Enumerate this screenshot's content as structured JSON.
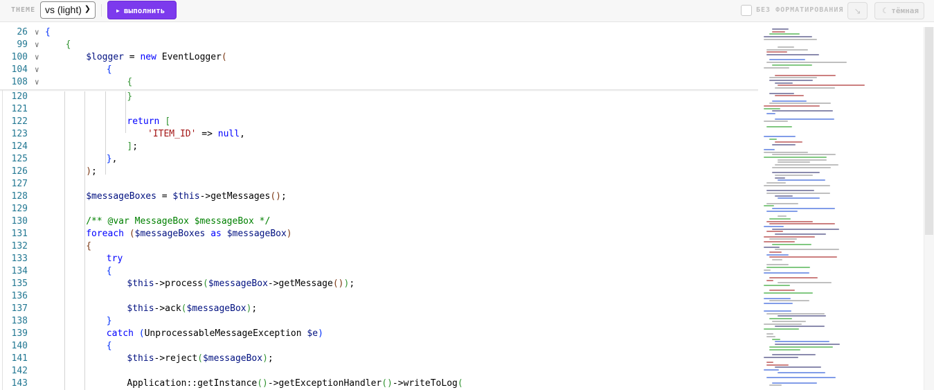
{
  "toolbar": {
    "theme_label": "THEME",
    "theme_value": "vs (light)",
    "run_label": "выполнить",
    "no_format_label": "БЕЗ ФОРМАТИРОВАНИЯ",
    "dark_label": "тёмная"
  },
  "colors": {
    "accent": "#7c3aed",
    "line_number": "#237893",
    "keyword": "#0000ff",
    "variable": "#001080",
    "string": "#a31515",
    "comment": "#008000"
  },
  "sticky_lines": [
    {
      "number": "26",
      "indent": 0,
      "tokens": [
        [
          "b1",
          "{"
        ]
      ]
    },
    {
      "number": "99",
      "indent": 1,
      "tokens": [
        [
          "b2",
          "{"
        ]
      ]
    },
    {
      "number": "100",
      "indent": 2,
      "tokens": [
        [
          "var",
          "$logger"
        ],
        [
          "",
          " = "
        ],
        [
          "kw",
          "new"
        ],
        [
          "",
          " EventLogger"
        ],
        [
          "b3",
          "("
        ]
      ]
    },
    {
      "number": "104",
      "indent": 3,
      "tokens": [
        [
          "b1",
          "{"
        ]
      ]
    },
    {
      "number": "108",
      "indent": 4,
      "tokens": [
        [
          "b2",
          "{"
        ]
      ]
    }
  ],
  "lines": [
    {
      "number": "120",
      "indent": 4,
      "tokens": [
        [
          "b2",
          "}"
        ]
      ]
    },
    {
      "number": "121",
      "indent": 0,
      "tokens": []
    },
    {
      "number": "122",
      "indent": 4,
      "tokens": [
        [
          "kw",
          "return"
        ],
        [
          "",
          " "
        ],
        [
          "b2",
          "["
        ]
      ]
    },
    {
      "number": "123",
      "indent": 5,
      "tokens": [
        [
          "str",
          "'ITEM_ID'"
        ],
        [
          "",
          " => "
        ],
        [
          "kw",
          "null"
        ],
        [
          "",
          ","
        ]
      ]
    },
    {
      "number": "124",
      "indent": 4,
      "tokens": [
        [
          "b2",
          "]"
        ],
        [
          "",
          ";"
        ]
      ]
    },
    {
      "number": "125",
      "indent": 3,
      "tokens": [
        [
          "b1",
          "}"
        ],
        [
          "",
          ","
        ]
      ]
    },
    {
      "number": "126",
      "indent": 2,
      "tokens": [
        [
          "b3",
          ")"
        ],
        [
          "",
          ";"
        ]
      ]
    },
    {
      "number": "127",
      "indent": 0,
      "tokens": []
    },
    {
      "number": "128",
      "indent": 2,
      "tokens": [
        [
          "var",
          "$messageBoxes"
        ],
        [
          "",
          " = "
        ],
        [
          "var",
          "$this"
        ],
        [
          "",
          "->getMessages"
        ],
        [
          "b3",
          "()"
        ],
        [
          "",
          ";"
        ]
      ]
    },
    {
      "number": "129",
      "indent": 0,
      "tokens": []
    },
    {
      "number": "130",
      "indent": 2,
      "tokens": [
        [
          "cmt",
          "/** @var MessageBox $messageBox */"
        ]
      ]
    },
    {
      "number": "131",
      "indent": 2,
      "tokens": [
        [
          "kw",
          "foreach"
        ],
        [
          "",
          " "
        ],
        [
          "b3",
          "("
        ],
        [
          "var",
          "$messageBoxes"
        ],
        [
          "",
          " "
        ],
        [
          "kw",
          "as"
        ],
        [
          "",
          " "
        ],
        [
          "var",
          "$messageBox"
        ],
        [
          "b3",
          ")"
        ]
      ]
    },
    {
      "number": "132",
      "indent": 2,
      "tokens": [
        [
          "b3",
          "{"
        ]
      ]
    },
    {
      "number": "133",
      "indent": 3,
      "tokens": [
        [
          "kw",
          "try"
        ]
      ]
    },
    {
      "number": "134",
      "indent": 3,
      "tokens": [
        [
          "b1",
          "{"
        ]
      ]
    },
    {
      "number": "135",
      "indent": 4,
      "tokens": [
        [
          "var",
          "$this"
        ],
        [
          "",
          "->process"
        ],
        [
          "b2",
          "("
        ],
        [
          "var",
          "$messageBox"
        ],
        [
          "",
          "->getMessage"
        ],
        [
          "b3",
          "()"
        ],
        [
          "b2",
          ")"
        ],
        [
          "",
          ";"
        ]
      ]
    },
    {
      "number": "136",
      "indent": 0,
      "tokens": []
    },
    {
      "number": "137",
      "indent": 4,
      "tokens": [
        [
          "var",
          "$this"
        ],
        [
          "",
          "->ack"
        ],
        [
          "b2",
          "("
        ],
        [
          "var",
          "$messageBox"
        ],
        [
          "b2",
          ")"
        ],
        [
          "",
          ";"
        ]
      ]
    },
    {
      "number": "138",
      "indent": 3,
      "tokens": [
        [
          "b1",
          "}"
        ]
      ]
    },
    {
      "number": "139",
      "indent": 3,
      "tokens": [
        [
          "kw",
          "catch"
        ],
        [
          "",
          " "
        ],
        [
          "b1",
          "("
        ],
        [
          "",
          "UnprocessableMessageException "
        ],
        [
          "var",
          "$e"
        ],
        [
          "b1",
          ")"
        ]
      ]
    },
    {
      "number": "140",
      "indent": 3,
      "tokens": [
        [
          "b1",
          "{"
        ]
      ]
    },
    {
      "number": "141",
      "indent": 4,
      "tokens": [
        [
          "var",
          "$this"
        ],
        [
          "",
          "->reject"
        ],
        [
          "b2",
          "("
        ],
        [
          "var",
          "$messageBox"
        ],
        [
          "b2",
          ")"
        ],
        [
          "",
          ";"
        ]
      ]
    },
    {
      "number": "142",
      "indent": 0,
      "tokens": []
    },
    {
      "number": "143",
      "indent": 4,
      "tokens": [
        [
          "",
          "Application::getInstance"
        ],
        [
          "b2",
          "()"
        ],
        [
          "",
          "->getExceptionHandler"
        ],
        [
          "b2",
          "()"
        ],
        [
          "",
          "->writeToLog"
        ],
        [
          "b2",
          "("
        ]
      ]
    }
  ]
}
